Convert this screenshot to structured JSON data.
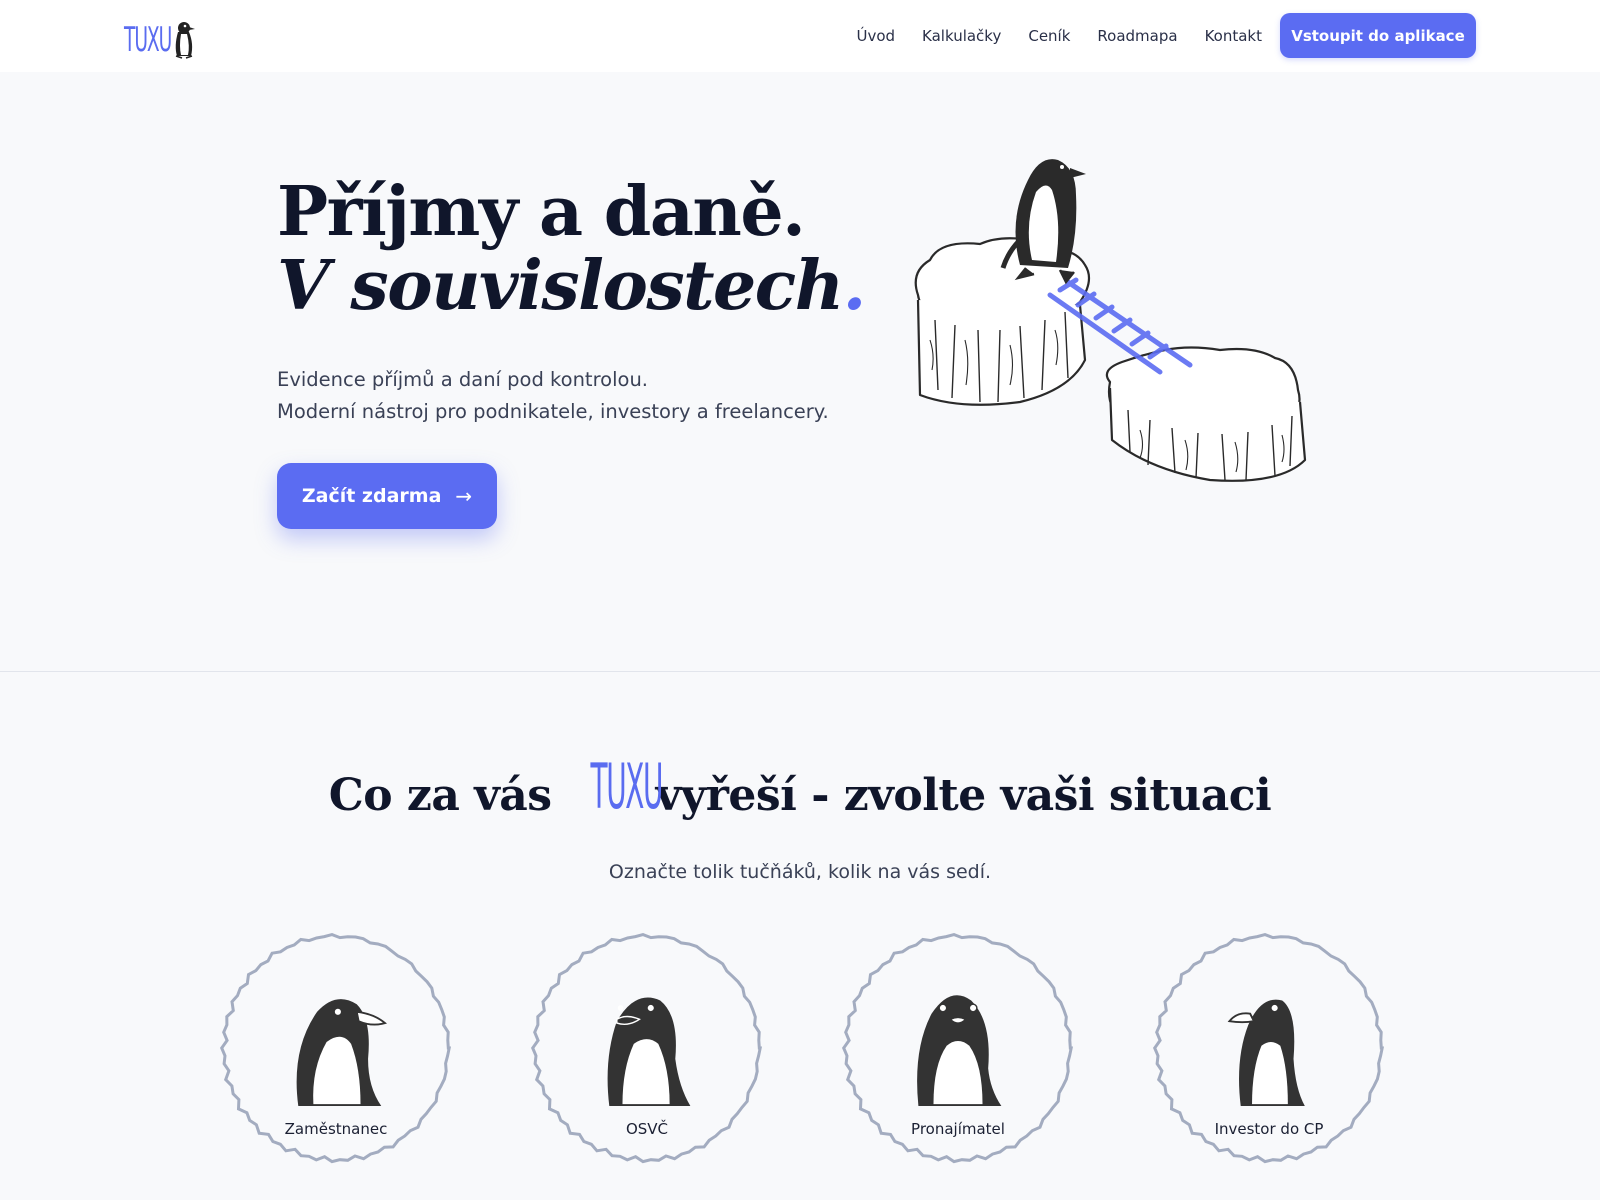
{
  "brand": {
    "logo_text": "TUXU",
    "accent": "#5b6cf2"
  },
  "nav": {
    "links": [
      "Úvod",
      "Kalkulačky",
      "Ceník",
      "Roadmapa",
      "Kontakt"
    ],
    "cta": "Vstoupit do aplikace"
  },
  "hero": {
    "title_line1": "Příjmy a daně.",
    "title_line2": "V souvislostech",
    "title_dot": ".",
    "subtitle_line1": "Evidence příjmů a daní pod kontrolou.",
    "subtitle_line2": "Moderní nástroj pro podnikatele, investory a freelancery.",
    "cta": "Začít zdarma",
    "cta_icon": "arrow-right-icon"
  },
  "situations": {
    "title_before": "Co za vás",
    "title_logo": "TUXU",
    "title_after": "vyřeší - zvolte vaši situaci",
    "subtitle": "Označte tolik tučňáků, kolik na vás sedí.",
    "personas": [
      {
        "label": "Zaměstnanec",
        "icon": "penguin-employee-icon"
      },
      {
        "label": "OSVČ",
        "icon": "penguin-freelancer-icon"
      },
      {
        "label": "Pronajímatel",
        "icon": "penguin-landlord-icon"
      },
      {
        "label": "Investor do CP",
        "icon": "penguin-investor-icon"
      }
    ]
  }
}
